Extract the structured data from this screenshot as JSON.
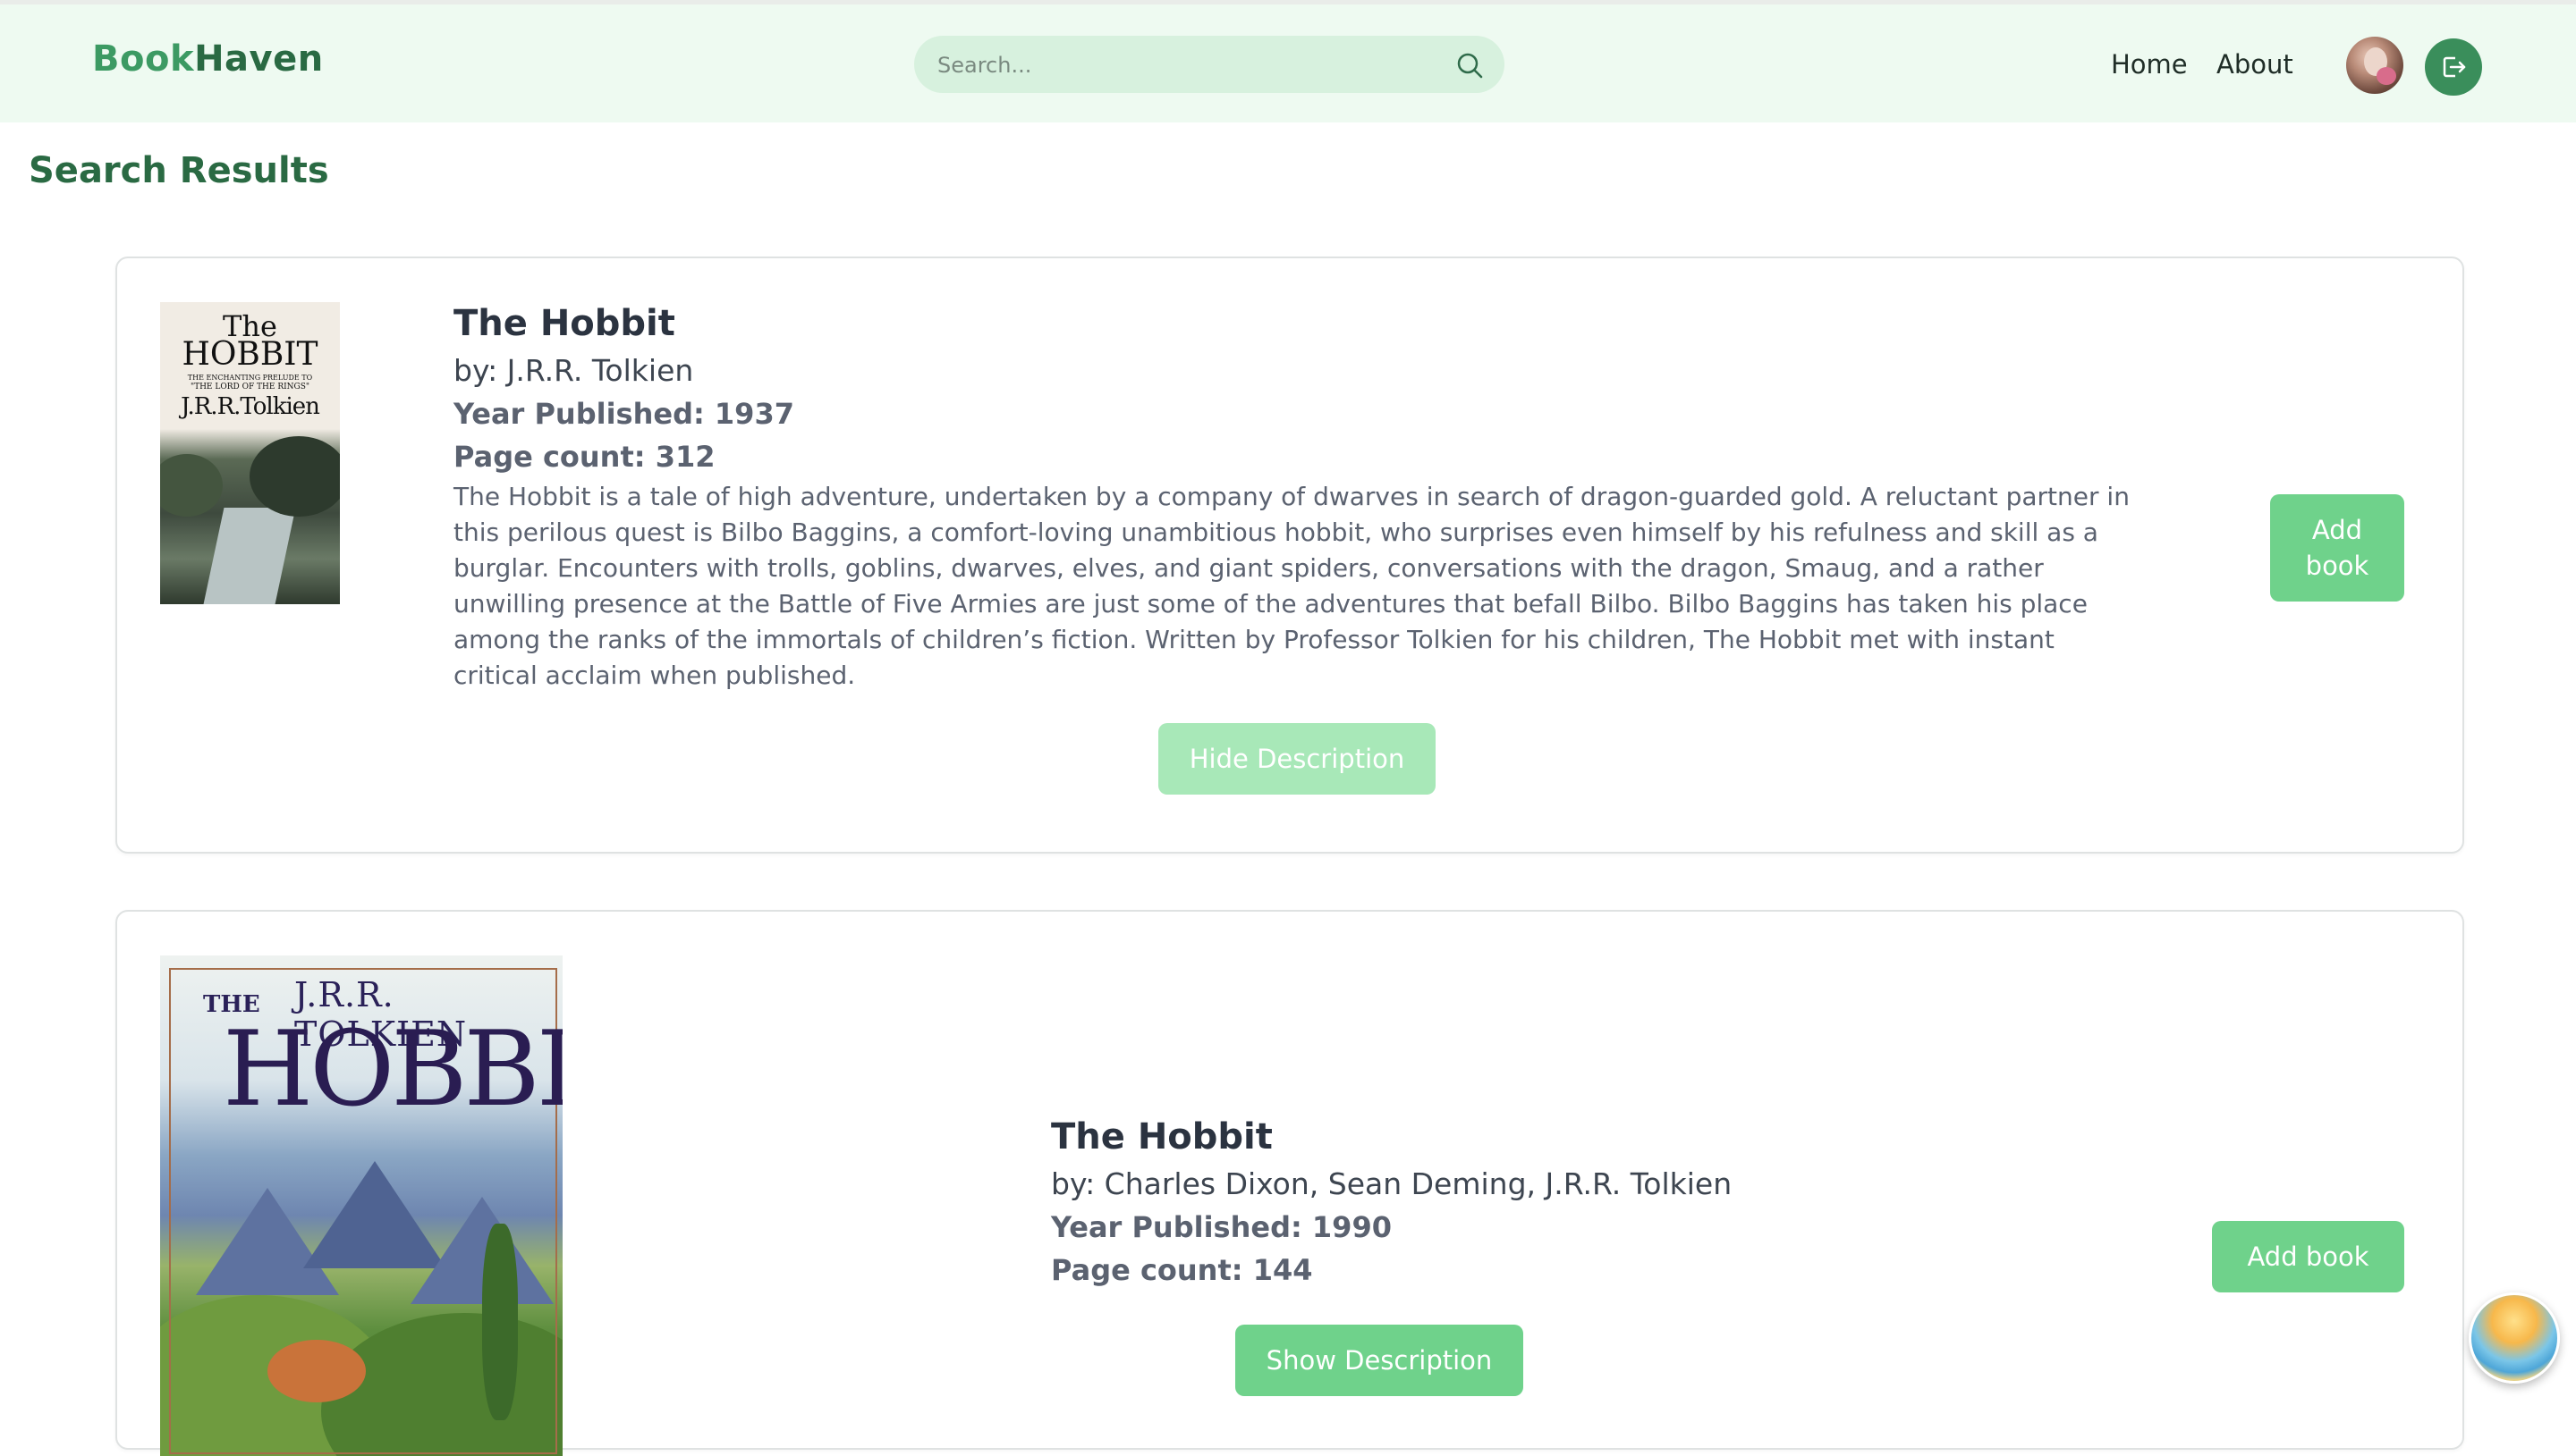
{
  "header": {
    "brand_part1": "Book",
    "brand_part2": "Haven",
    "search_placeholder": "Search...",
    "nav": [
      {
        "label": "Home"
      },
      {
        "label": "About"
      }
    ]
  },
  "main": {
    "title": "Search Results",
    "results": [
      {
        "cover_text": [
          "The",
          "HOBBIT",
          "THE ENCHANTING PRELUDE TO",
          "\"THE LORD OF THE RINGS\"",
          "J.R.R.Tolkien"
        ],
        "title": "The Hobbit",
        "author": "by: J.R.R. Tolkien",
        "year": "Year Published: 1937",
        "pages": "Page count: 312",
        "description": "The Hobbit is a tale of high adventure, undertaken by a company of dwarves in search of dragon-guarded gold. A reluctant partner in this perilous quest is Bilbo Baggins, a comfort-loving unambitious hobbit, who surprises even himself by his refulness and skill as a burglar. Encounters with trolls, goblins, dwarves, elves, and giant spiders, conversations with the dragon, Smaug, and a rather unwilling presence at the Battle of Five Armies are just some of the adventures that befall Bilbo. Bilbo Baggins has taken his place among the ranks of the immortals of children’s fiction. Written by Professor Tolkien for his children, The Hobbit met with instant critical acclaim when published.",
        "add_label": "Add book",
        "toggle_label": "Hide Description"
      },
      {
        "cover_text": [
          "J.R.R. TOLKIEN",
          "THE",
          "HOBBIT"
        ],
        "title": "The Hobbit",
        "author": "by: Charles Dixon, Sean Deming, J.R.R. Tolkien",
        "year": "Year Published: 1990",
        "pages": "Page count: 144",
        "add_label": "Add book",
        "toggle_label": "Show Description"
      }
    ]
  },
  "colors": {
    "navbar_bg": "#eefaf1",
    "brand_light": "#3c9a63",
    "brand_dark": "#2a6a43",
    "button_green": "#6fd28b",
    "button_green_light": "#a8e8b8"
  },
  "icons": {
    "search": "search-icon",
    "logout": "logout-icon",
    "avatar": "user-avatar",
    "floating": "floating-app-badge"
  }
}
